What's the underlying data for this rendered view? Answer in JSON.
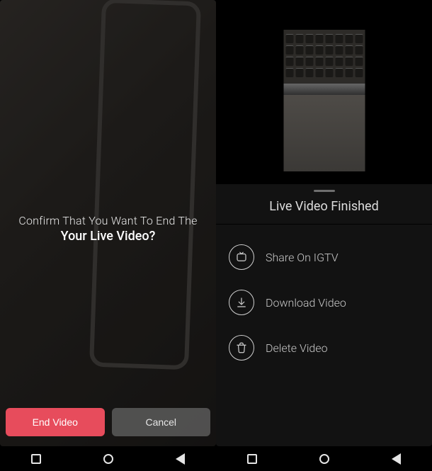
{
  "left_panel": {
    "confirm_line1": "Confirm That You Want To End The",
    "confirm_line2": "Your Live Video?",
    "end_button_label": "End Video",
    "cancel_button_label": "Cancel"
  },
  "right_panel": {
    "sheet_title": "Live Video Finished",
    "actions": [
      {
        "icon": "igtv-icon",
        "label": "Share On IGTV"
      },
      {
        "icon": "download-icon",
        "label": "Download Video"
      },
      {
        "icon": "trash-icon",
        "label": "Delete Video"
      }
    ]
  },
  "nav": {
    "recent": "recent-apps",
    "home": "home",
    "back": "back"
  }
}
